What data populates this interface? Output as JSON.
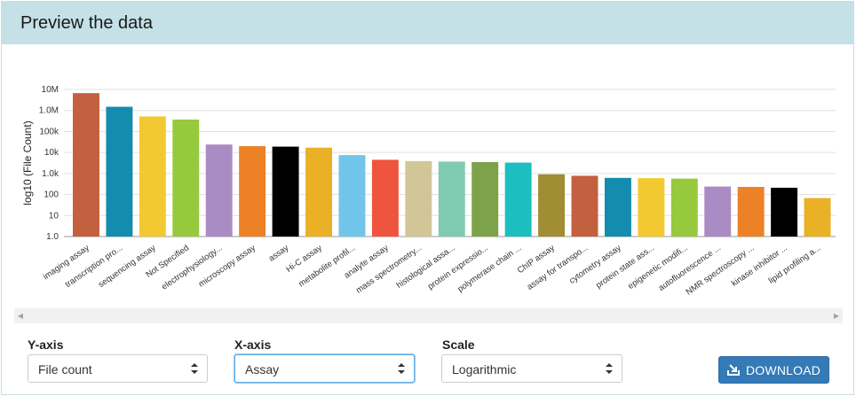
{
  "header": {
    "title": "Preview the data"
  },
  "chart_data": {
    "type": "bar",
    "ylabel": "log10 (File Count)",
    "xlabel": "",
    "yscale": "log",
    "ylim": [
      1,
      10000000
    ],
    "yticks": [
      "1.0",
      "10",
      "100",
      "1.0k",
      "10k",
      "100k",
      "1.0M",
      "10M"
    ],
    "grid": "horizontal",
    "categories": [
      "imaging assay",
      "transcription pro...",
      "sequencing assay",
      "Not Specified",
      "electrophysiology...",
      "microscopy assay",
      "assay",
      "Hi-C assay",
      "metabolite profil...",
      "analyte assay",
      "mass spectrometry...",
      "histological assa...",
      "protein expressio...",
      "polymerase chain ...",
      "ChIP assay",
      "assay for transpo...",
      "cytometry assay",
      "protein state ass...",
      "epigenetic modifi...",
      "autofluorescence ...",
      "NMR spectroscopy ...",
      "kinase inhibitor ...",
      "lipid profiling a..."
    ],
    "values": [
      6700000,
      1500000,
      520000,
      370000,
      24000,
      20000,
      19000,
      17000,
      7500,
      4500,
      3900,
      3700,
      3500,
      3300,
      920,
      780,
      620,
      600,
      570,
      240,
      230,
      210,
      68
    ],
    "colors": [
      "#c2603f",
      "#138caf",
      "#f2c931",
      "#97c93d",
      "#a98cc4",
      "#ec8126",
      "#000000",
      "#eab126",
      "#71c5ea",
      "#ef553e",
      "#d2c699",
      "#7ecbb2",
      "#7ea24a",
      "#1cbfc0",
      "#a08d34",
      "#c2603f",
      "#138caf",
      "#f2c931",
      "#97c93d",
      "#a98cc4",
      "#ec8126",
      "#000000",
      "#eab126"
    ]
  },
  "controls": {
    "y_axis": {
      "label": "Y-axis",
      "value": "File count"
    },
    "x_axis": {
      "label": "X-axis",
      "value": "Assay"
    },
    "scale": {
      "label": "Scale",
      "value": "Logarithmic"
    },
    "download_label": "DOWNLOAD"
  },
  "icons": {
    "scroll_left": "◀",
    "scroll_right": "▶",
    "download": "download-icon",
    "caret": "select-caret-icon"
  }
}
